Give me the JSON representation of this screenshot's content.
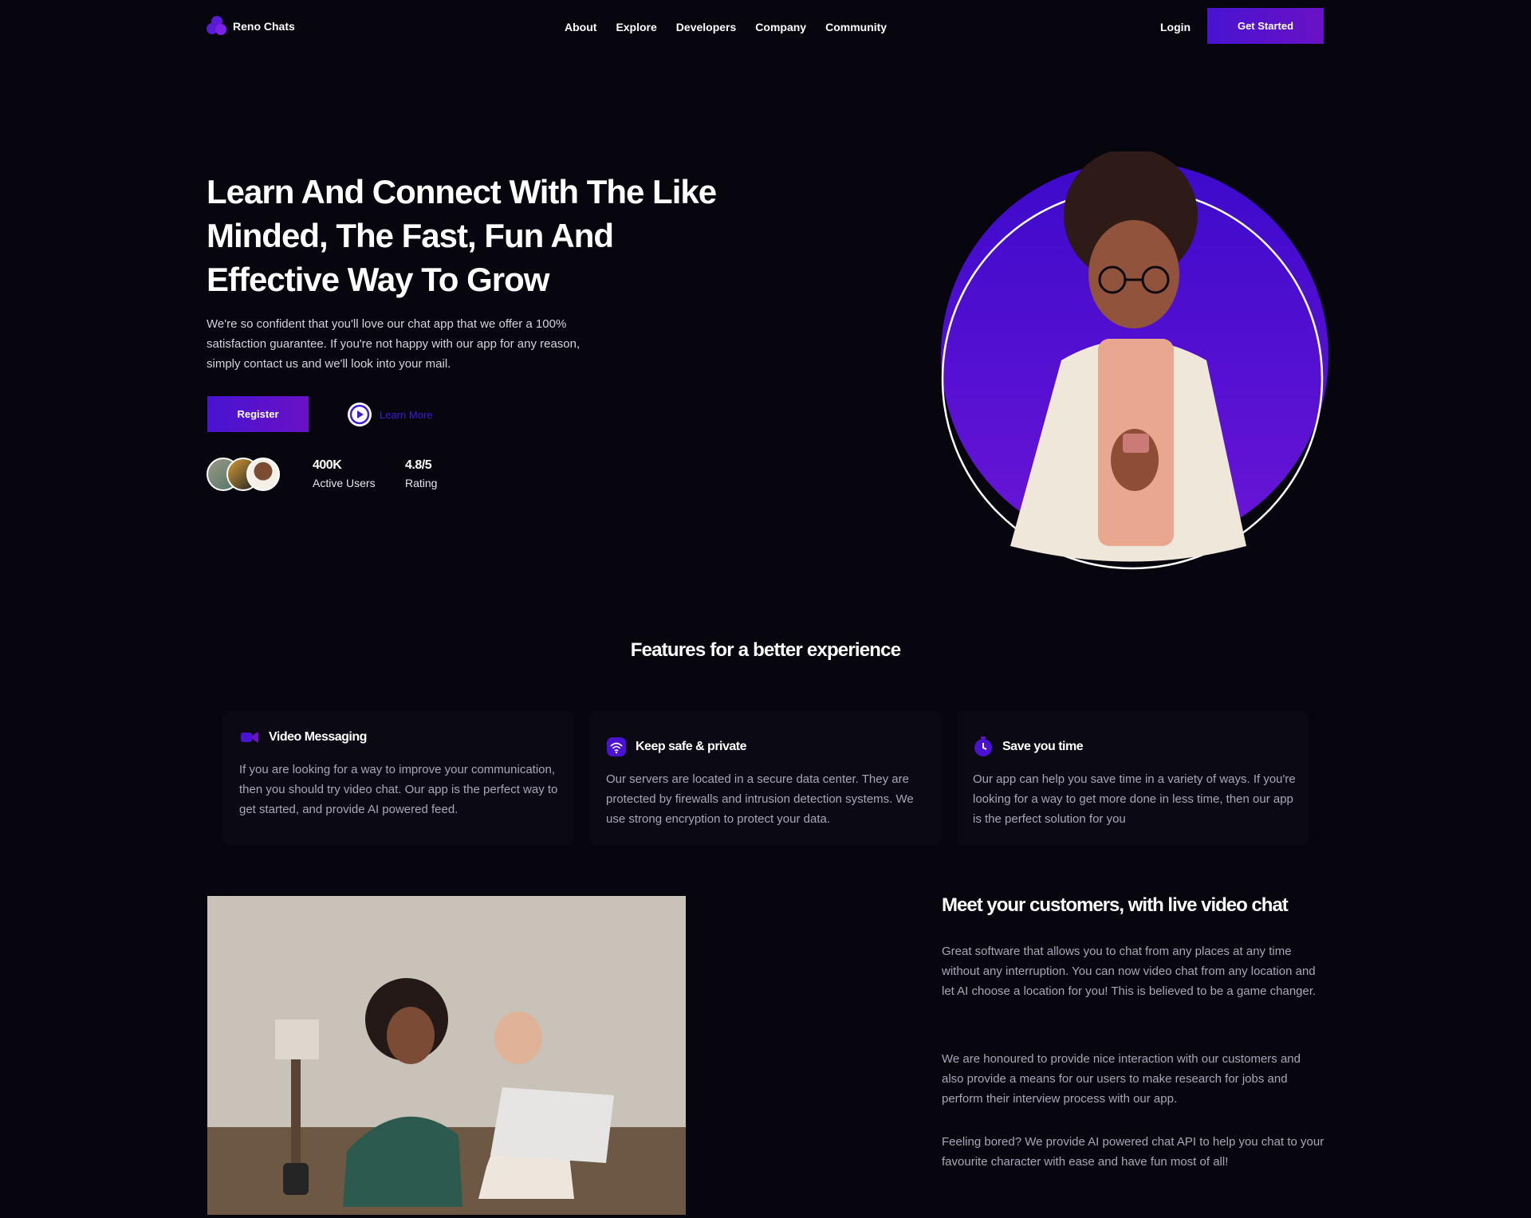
{
  "brand": {
    "name": "Reno Chats"
  },
  "nav": {
    "links": [
      "About",
      "Explore",
      "Developers",
      "Company",
      "Community"
    ],
    "login": "Login",
    "cta": "Get Started"
  },
  "hero": {
    "title": "Learn And Connect With The Like Minded, The Fast, Fun And Effective Way To Grow",
    "text": "We're so confident that you'll love our chat app that we offer a 100% satisfaction guarantee. If you're not happy with our app for any reason, simply contact us and we'll look into your mail.",
    "register": "Register",
    "learn_more": "Learn More",
    "stats": [
      {
        "value": "400K",
        "label": "Active Users"
      },
      {
        "value": "4.8/5",
        "label": "Rating"
      }
    ]
  },
  "features": {
    "heading": "Features for a better experience",
    "items": [
      {
        "icon": "video-camera-icon",
        "title": "Video Messaging",
        "text": "If you are looking for a way to improve your communication, then you should try video chat. Our app is the perfect way to get started, and provide AI powered feed."
      },
      {
        "icon": "wifi-shield-icon",
        "title": "Keep safe & private",
        "text": "Our servers are located in a secure data center. They are protected by firewalls and intrusion detection systems. We use strong encryption to protect your data."
      },
      {
        "icon": "stopwatch-icon",
        "title": "Save you time",
        "text": "Our app can help you save time in a variety of ways. If you're looking for a way to get more done in less time, then our app is the perfect solution for you"
      }
    ]
  },
  "video_chat": {
    "title": "Meet your customers, with live video chat",
    "paragraphs": [
      "Great software that allows you to chat from any places at any time without any interruption. You can now video chat from any location and let AI choose a location for you! This is believed to be a game changer.",
      "We are honoured to provide nice interaction with our customers and also provide a means for our users to make research for jobs and perform their interview process with our app.",
      "Feeling bored? We provide AI powered chat API to help you chat to your favourite character with ease and have fun most of all!"
    ]
  },
  "colors": {
    "background": "#07060f",
    "accent": "#5a12d8",
    "learn_more": "#3f1bd6"
  }
}
